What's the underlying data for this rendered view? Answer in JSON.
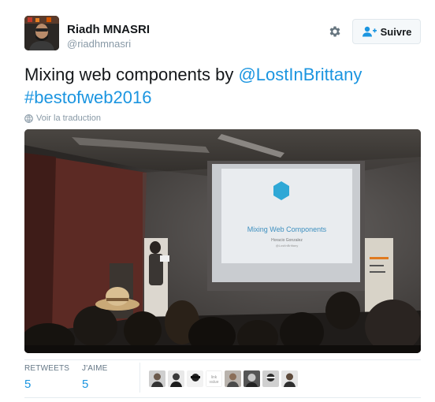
{
  "author": {
    "name": "Riadh MNASRI",
    "handle": "@riadhmnasri",
    "avatar_icon": "profile-photo"
  },
  "actions": {
    "settings_icon": "gear-icon",
    "follow_label": "Suivre",
    "follow_icon": "person-plus-icon"
  },
  "tweet": {
    "text_plain": "Mixing web components by ",
    "mention": "@LostInBrittany",
    "hashtag": "#bestofweb2016",
    "translate_label": "Voir la traduction",
    "translate_icon": "globe-icon",
    "media": {
      "slide_title": "Mixing Web Components",
      "slide_subtitle": "Horacio Gonzalez",
      "slide_handle": "@LostInBrittany"
    }
  },
  "stats": {
    "retweets_label": "RETWEETS",
    "retweets_value": "5",
    "likes_label": "J'AIME",
    "likes_value": "5"
  },
  "likers": [
    {
      "name": "liker-avatar-1"
    },
    {
      "name": "liker-avatar-2"
    },
    {
      "name": "liker-avatar-3"
    },
    {
      "name": "liker-avatar-4",
      "text": "link value"
    },
    {
      "name": "liker-avatar-5"
    },
    {
      "name": "liker-avatar-6"
    },
    {
      "name": "liker-avatar-7"
    },
    {
      "name": "liker-avatar-8"
    }
  ],
  "colors": {
    "link": "#1b95e0",
    "muted": "#8899a6",
    "text": "#14171a",
    "border": "#e6ecf0"
  }
}
